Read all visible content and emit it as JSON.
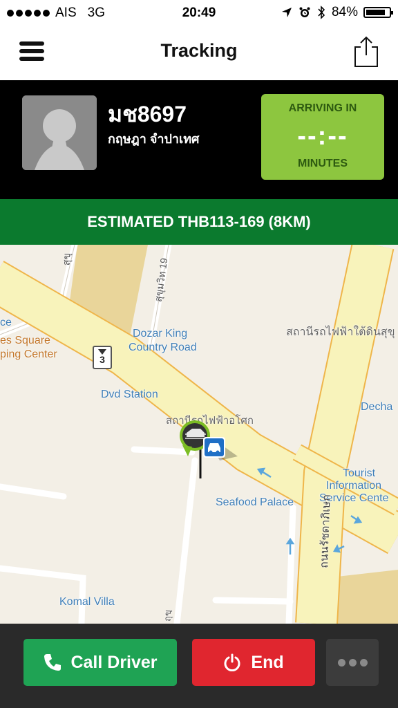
{
  "status_bar": {
    "carrier": "AIS",
    "network": "3G",
    "time": "20:49",
    "battery": "84%",
    "battery_level": 0.84,
    "icons": [
      "signal-dots-icon",
      "location-arrow-icon",
      "alarm-icon",
      "bluetooth-icon",
      "battery-icon"
    ]
  },
  "nav": {
    "title": "Tracking",
    "menu_icon": "hamburger-menu-icon",
    "share_icon": "share-icon"
  },
  "driver": {
    "plate": "มช8697",
    "name": "กฤษฎา จำปาเทศ",
    "avatar_icon": "default-avatar-icon"
  },
  "eta": {
    "label_top": "ARRIVING IN",
    "time": "--:--",
    "label_bottom": "MINUTES",
    "bg_color": "#8dc63f"
  },
  "estimate": {
    "text": "ESTIMATED THB113-169 (8KM)",
    "bg_color": "#0b7a2e"
  },
  "map": {
    "labels": {
      "dozar": "Dozar King",
      "country_road": "Country Road",
      "dvd": "Dvd Station",
      "thai_station_top": "สถานีรถไฟฟ้าใต้ดินสุขุ",
      "thai_station_mid": "สถานีรถไฟฟ้าอโศก",
      "seafood": "Seafood Palace",
      "tourist1": "Tourist",
      "tourist2": "Information",
      "tourist3": "Service Cente",
      "dech": "Decha",
      "komal": "Komal Villa",
      "times1": "es Square",
      "times2": "ping Center",
      "ce": "ce",
      "road_sukhumvit19": "สุขุมวิท 19",
      "road_sukhumvit": "สุขุ",
      "road_ratchada": "ถนนรัชดาภิเษก",
      "road_bottom": "ถุขฺ",
      "shield_number": "3"
    },
    "pin_icon": "car-pin-icon",
    "shield_icon": "highway-shield-icon"
  },
  "actions": {
    "call_label": "Call Driver",
    "call_icon": "phone-icon",
    "call_color": "#1fa354",
    "end_label": "End",
    "end_icon": "power-icon",
    "end_color": "#e0262f",
    "more_icon": "more-dots-icon"
  }
}
